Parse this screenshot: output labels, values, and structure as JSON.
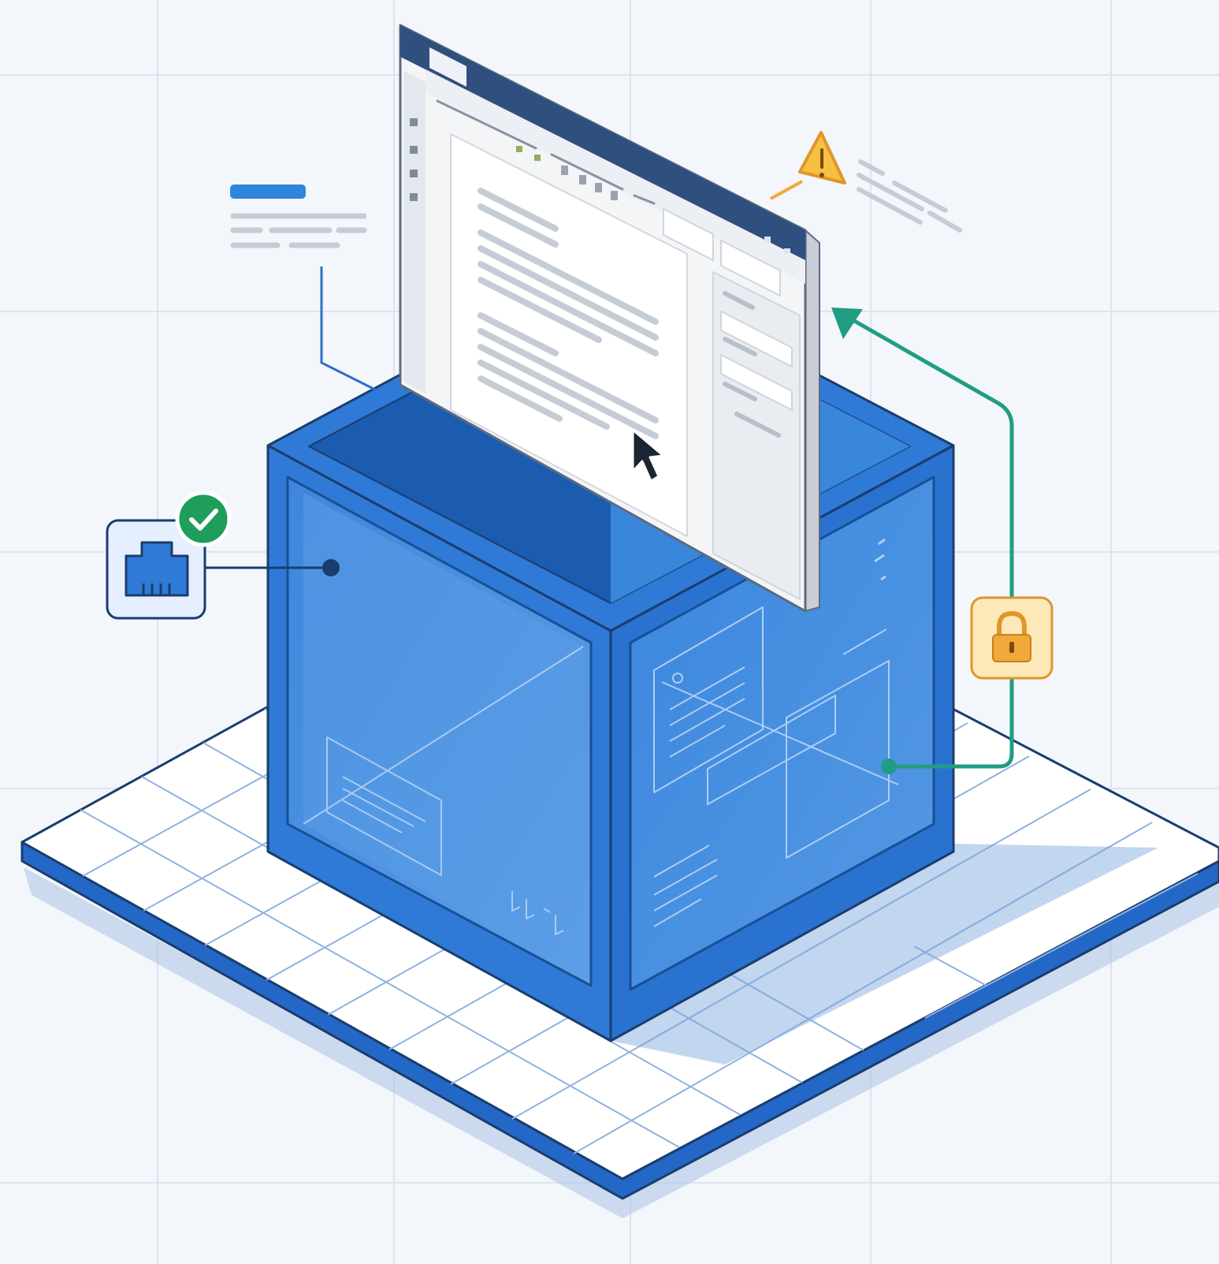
{
  "colors": {
    "background": "#f3f6fa",
    "grid_line": "#dde4ee",
    "box_blue": "#2f7ad6",
    "box_blue_dark": "#1b5bb0",
    "box_face_light": "#4a90e2",
    "outline_navy": "#1a3d6e",
    "platform_white": "#ffffff",
    "status_green": "#1f9d5b",
    "connector_teal": "#1f9d82",
    "warning_amber": "#f2b33d",
    "lock_amber": "#f2a93b",
    "callout_blue": "#2d86d9",
    "text_line_gray": "#c6ccd6",
    "window_chrome": "#2f4f7e"
  },
  "icons": {
    "network_port": "ethernet-port-icon",
    "status_ok": "checkmark-icon",
    "warning": "warning-triangle-icon",
    "lock": "padlock-icon",
    "cursor": "mouse-pointer-icon"
  },
  "ui_window": {
    "kind": "document-editor-window",
    "has_sidebar_panel": true,
    "cursor_visible": true
  }
}
